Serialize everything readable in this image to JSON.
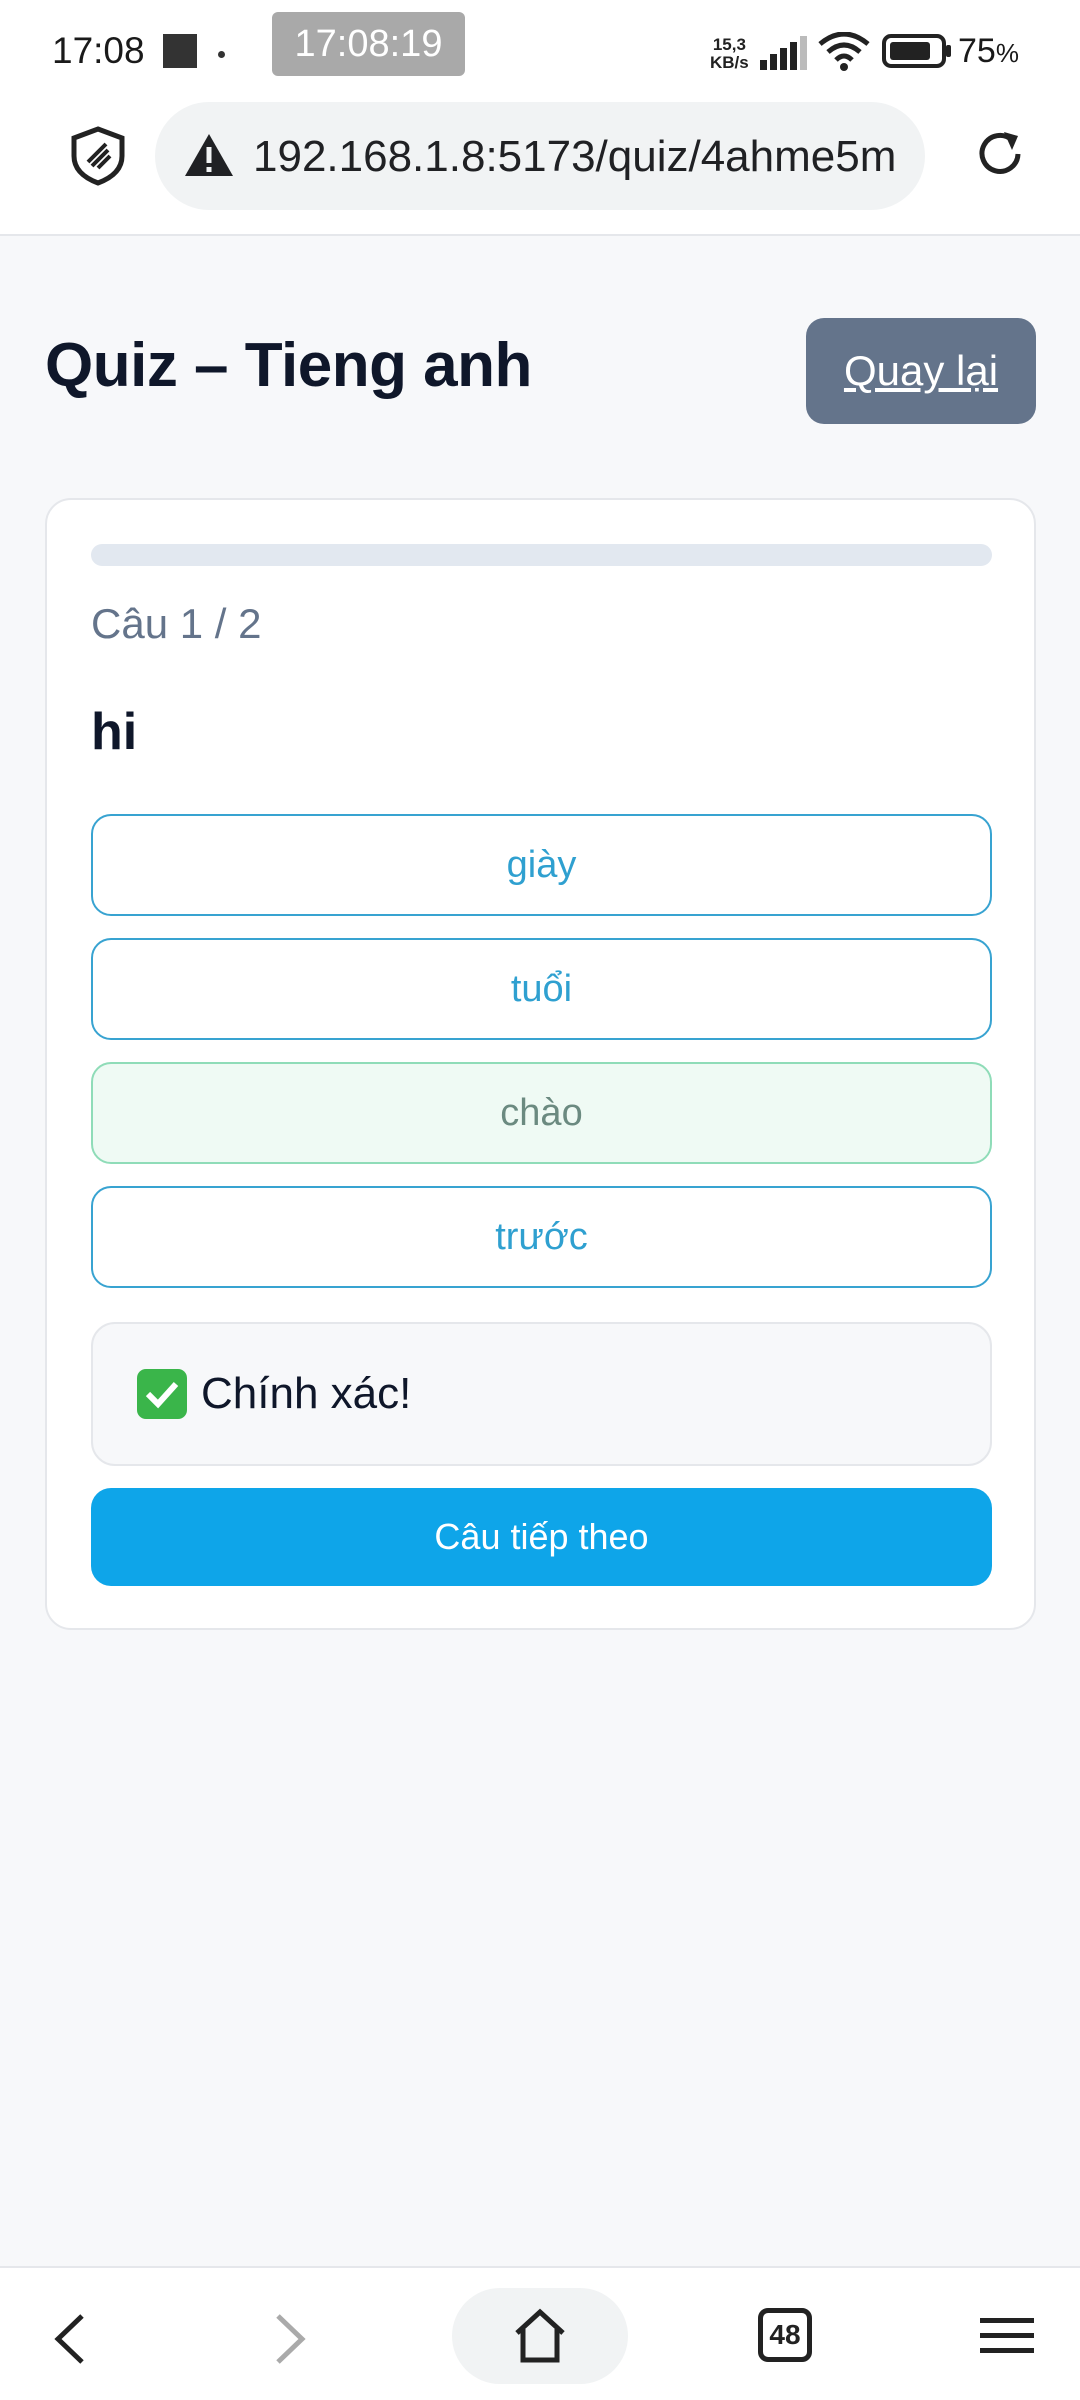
{
  "status_bar": {
    "time": "17:08",
    "clock_pill": "17:08:19",
    "speed_top": "15,3",
    "speed_bottom": "KB/s",
    "battery": "75",
    "battery_unit": "%"
  },
  "browser": {
    "url": "192.168.1.8:5173/quiz/4ahme5m",
    "tab_count": "48"
  },
  "page": {
    "title": "Quiz – Tieng anh",
    "back_label": "Quay lại"
  },
  "quiz": {
    "progress": 0,
    "counter": "Câu 1 / 2",
    "word": "hi",
    "options": [
      {
        "label": "giày",
        "state": "default"
      },
      {
        "label": "tuổi",
        "state": "default"
      },
      {
        "label": "chào",
        "state": "correct"
      },
      {
        "label": "trước",
        "state": "default"
      }
    ],
    "feedback": "Chính xác!",
    "next_label": "Câu tiếp theo"
  },
  "colors": {
    "primary": "#0ea5e9",
    "option_border": "#38a3d1",
    "correct_bg": "#effaf4",
    "back_button": "#64748b"
  },
  "icons": [
    "shield-icon",
    "warning-icon",
    "reload-icon",
    "check-icon",
    "back-arrow-icon",
    "forward-arrow-icon",
    "home-icon",
    "tabs-icon",
    "menu-icon"
  ]
}
